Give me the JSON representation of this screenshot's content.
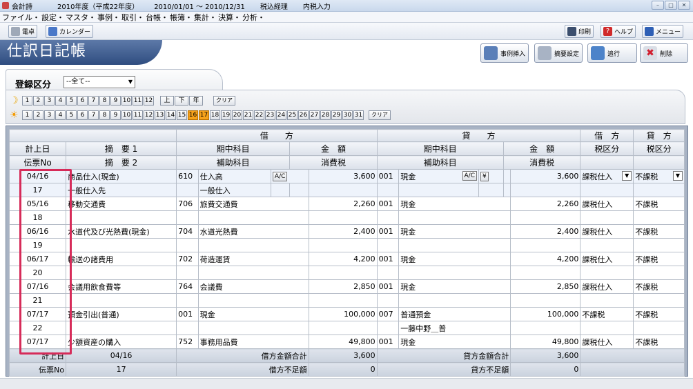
{
  "titlebar": {
    "app": "会計詩",
    "fiscal_year": "2010年度（平成22年度）",
    "period": "2010/01/01 ～ 2010/12/31",
    "tax_mode": "税込経理",
    "input_mode": "内税入力"
  },
  "menu": [
    "ファイル・",
    "設定・",
    "マスタ・",
    "事例・",
    "取引・",
    "台帳・",
    "帳簿・",
    "集計・",
    "決算・",
    "分析・"
  ],
  "toolbar": {
    "left": [
      "電卓",
      "カレンダー"
    ],
    "right": [
      "印刷",
      "ヘルプ",
      "メニュー"
    ]
  },
  "page_title": "仕訳日記帳",
  "actions": [
    "事例挿入",
    "摘要設定",
    "追行",
    "削除"
  ],
  "filter": {
    "label": "登録区分",
    "select_value": "--全て--",
    "months": [
      "1",
      "2",
      "3",
      "4",
      "5",
      "6",
      "7",
      "8",
      "9",
      "10",
      "11",
      "12",
      "上",
      "下",
      "年"
    ],
    "days": [
      "1",
      "2",
      "3",
      "4",
      "5",
      "6",
      "7",
      "8",
      "9",
      "10",
      "11",
      "12",
      "13",
      "14",
      "15",
      "16",
      "17",
      "18",
      "19",
      "20",
      "21",
      "22",
      "23",
      "24",
      "25",
      "26",
      "27",
      "28",
      "29",
      "30",
      "31"
    ],
    "selected_days": [
      "16",
      "17"
    ],
    "clear_label": "クリア"
  },
  "grid": {
    "group_headers": {
      "debit": "借　　方",
      "credit": "貸　　方",
      "debit_tax": "借　方",
      "credit_tax": "貸　方"
    },
    "headers1": [
      "計上日",
      "摘　要 1",
      "期中科目",
      "金　額",
      "期中科目",
      "金　額",
      "税区分",
      "税区分"
    ],
    "headers2": [
      "伝票No",
      "摘　要 2",
      "補助科目",
      "消費税",
      "補助科目",
      "消費税"
    ],
    "rows": [
      {
        "date": "04/16",
        "no": "17",
        "memo1": "商品仕入(現金)",
        "memo2": "一般仕入先",
        "dr_code": "610",
        "dr_acct": "仕入高",
        "dr_sub": "一般仕入",
        "dr_amt": "3,600",
        "cr_code": "001",
        "cr_acct": "現金",
        "cr_sub": "",
        "cr_amt": "3,600",
        "dr_tax": "課税仕入",
        "cr_tax": "不課税"
      },
      {
        "date": "05/16",
        "no": "18",
        "memo1": "移動交通費",
        "memo2": "",
        "dr_code": "706",
        "dr_acct": "旅費交通費",
        "dr_sub": "",
        "dr_amt": "2,260",
        "cr_code": "001",
        "cr_acct": "現金",
        "cr_sub": "",
        "cr_amt": "2,260",
        "dr_tax": "課税仕入",
        "cr_tax": "不課税"
      },
      {
        "date": "06/16",
        "no": "19",
        "memo1": "水道代及び光熱費(現金)",
        "memo2": "",
        "dr_code": "704",
        "dr_acct": "水道光熱費",
        "dr_sub": "",
        "dr_amt": "2,400",
        "cr_code": "001",
        "cr_acct": "現金",
        "cr_sub": "",
        "cr_amt": "2,400",
        "dr_tax": "課税仕入",
        "cr_tax": "不課税"
      },
      {
        "date": "06/17",
        "no": "20",
        "memo1": "輸送の諸費用",
        "memo2": "",
        "dr_code": "702",
        "dr_acct": "荷造運賃",
        "dr_sub": "",
        "dr_amt": "4,200",
        "cr_code": "001",
        "cr_acct": "現金",
        "cr_sub": "",
        "cr_amt": "4,200",
        "dr_tax": "課税仕入",
        "cr_tax": "不課税"
      },
      {
        "date": "07/16",
        "no": "21",
        "memo1": "会議用飲食費等",
        "memo2": "",
        "dr_code": "764",
        "dr_acct": "会議費",
        "dr_sub": "",
        "dr_amt": "2,850",
        "cr_code": "001",
        "cr_acct": "現金",
        "cr_sub": "",
        "cr_amt": "2,850",
        "dr_tax": "課税仕入",
        "cr_tax": "不課税"
      },
      {
        "date": "07/17",
        "no": "22",
        "memo1": "預金引出(普通)",
        "memo2": "",
        "dr_code": "001",
        "dr_acct": "現金",
        "dr_sub": "",
        "dr_amt": "100,000",
        "cr_code": "007",
        "cr_acct": "普通預金",
        "cr_sub": "一藤中野＿普",
        "cr_amt": "100,000",
        "dr_tax": "不課税",
        "cr_tax": "不課税"
      },
      {
        "date": "07/17",
        "no": "",
        "memo1": "少額資産の購入",
        "memo2": "",
        "dr_code": "752",
        "dr_acct": "事務用品費",
        "dr_sub": "",
        "dr_amt": "49,800",
        "cr_code": "001",
        "cr_acct": "現金",
        "cr_sub": "",
        "cr_amt": "49,800",
        "dr_tax": "課税仕入",
        "cr_tax": "不課税"
      }
    ],
    "ac_label": "A/C",
    "yen_label": "¥",
    "footer": {
      "date_label": "計上日",
      "date_value": "04/16",
      "no_label": "伝票No",
      "no_value": "17",
      "dr_total_label": "借方金額合計",
      "dr_total": "3,600",
      "dr_short_label": "借方不足額",
      "dr_short": "0",
      "cr_total_label": "貸方金額合計",
      "cr_total": "3,600",
      "cr_short_label": "貸方不足額",
      "cr_short": "0"
    }
  }
}
